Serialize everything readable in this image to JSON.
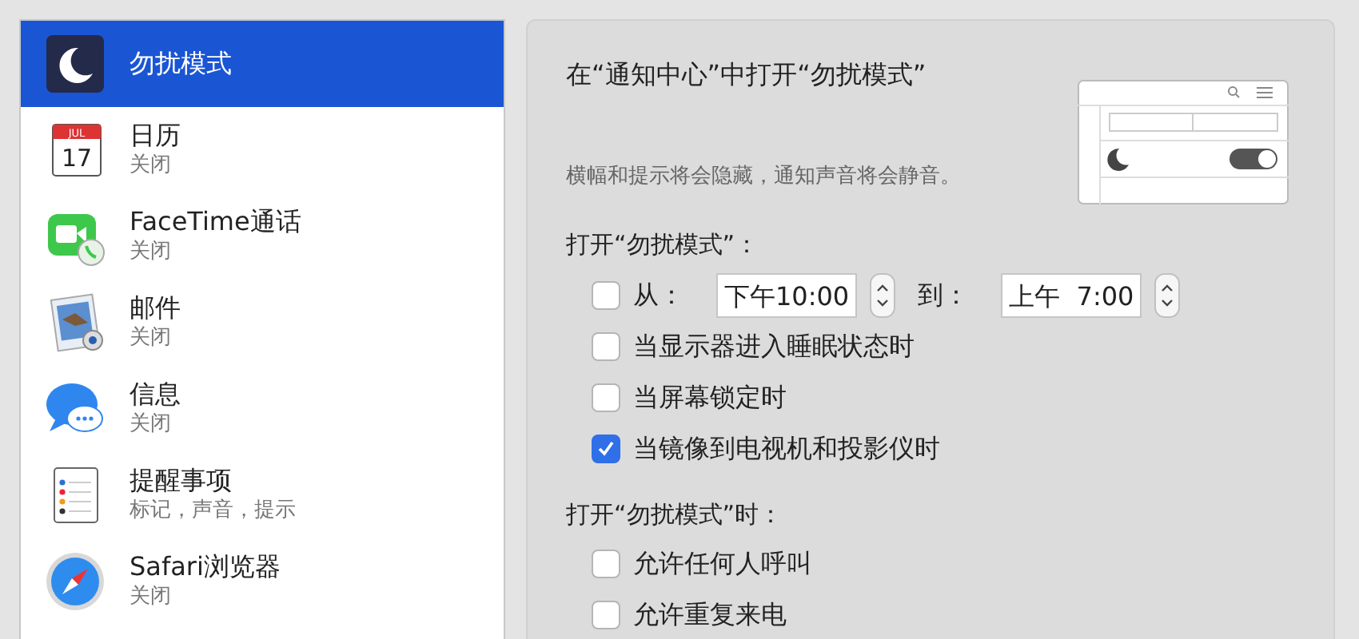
{
  "sidebar": {
    "items": [
      {
        "kind": "moon",
        "title": "勿扰模式",
        "selected": true
      },
      {
        "kind": "calendar",
        "title": "日历",
        "subtitle": "关闭",
        "icon_text": [
          "JUL",
          "17"
        ],
        "selected": false
      },
      {
        "kind": "facetime",
        "title": "FaceTime通话",
        "subtitle": "关闭",
        "selected": false
      },
      {
        "kind": "mail",
        "title": "邮件",
        "subtitle": "关闭",
        "selected": false
      },
      {
        "kind": "messages",
        "title": "信息",
        "subtitle": "关闭",
        "selected": false
      },
      {
        "kind": "reminders",
        "title": "提醒事项",
        "subtitle": "标记，声音，提示",
        "selected": false
      },
      {
        "kind": "safari",
        "title": "Safari浏览器",
        "subtitle": "关闭",
        "selected": false
      }
    ]
  },
  "panel": {
    "title": "在“通知中心”中打开“勿扰模式”",
    "description": "横幅和提示将会隐藏，通知声音将会静音。",
    "sections": [
      {
        "heading": "打开“勿扰模式”：",
        "options": [
          {
            "kind": "time-range",
            "label": "从：",
            "checked": false,
            "from": "下午10:00",
            "to_label": "到：",
            "to": "上午  7:00"
          },
          {
            "kind": "checkbox",
            "label": "当显示器进入睡眠状态时",
            "checked": false
          },
          {
            "kind": "checkbox",
            "label": "当屏幕锁定时",
            "checked": false
          },
          {
            "kind": "checkbox",
            "label": "当镜像到电视机和投影仪时",
            "checked": true
          }
        ]
      },
      {
        "heading": "打开“勿扰模式”时：",
        "options": [
          {
            "kind": "checkbox",
            "label": "允许任何人呼叫",
            "checked": false
          },
          {
            "kind": "checkbox",
            "label": "允许重复来电",
            "checked": false
          }
        ]
      }
    ]
  }
}
